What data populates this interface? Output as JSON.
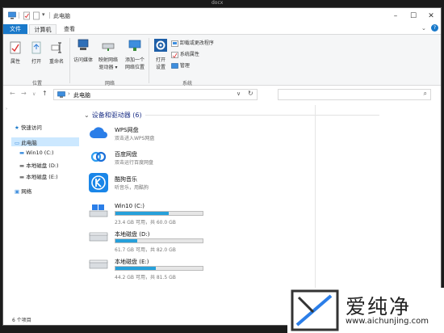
{
  "outer_title": "docx",
  "window": {
    "title": "此电脑"
  },
  "caption": {
    "minimize": "–",
    "maximize": "☐",
    "close": "✕"
  },
  "tabs": {
    "file": "文件",
    "computer": "计算机",
    "view": "查看"
  },
  "ribbon": {
    "location": {
      "properties": "属性",
      "open": "打开",
      "rename": "重命名",
      "group": "位置"
    },
    "network": {
      "access_media": "访问媒体",
      "map_drive_l1": "映射网络",
      "map_drive_l2": "驱动器 ▾",
      "add_location_l1": "添加一个",
      "add_location_l2": "网络位置",
      "group": "网络"
    },
    "system": {
      "open_settings_l1": "打开",
      "open_settings_l2": "设置",
      "uninstall": "卸载或更改程序",
      "sys_properties": "系统属性",
      "manage": "管理",
      "group": "系统"
    }
  },
  "address": {
    "path": "此电脑",
    "search_placeholder": ""
  },
  "nav": {
    "quick_access": "快速访问",
    "this_pc": "此电脑",
    "drives": [
      "Win10 (C:)",
      "本地磁盘 (D:)",
      "本地磁盘 (E:)"
    ],
    "network": "网络"
  },
  "section": {
    "title": "设备和驱动器 (6)"
  },
  "apps": [
    {
      "name": "WPS网盘",
      "sub": "双击进入WPS网盘"
    },
    {
      "name": "百度网盘",
      "sub": "双击运行百度网盘"
    },
    {
      "name": "酷狗音乐",
      "sub": "听音乐，用酷狗"
    }
  ],
  "drives": [
    {
      "name": "Win10 (C:)",
      "free": "23.4 GB 可用，共 60.0 GB",
      "used_pct": 61
    },
    {
      "name": "本地磁盘 (D:)",
      "free": "61.7 GB 可用，共 82.0 GB",
      "used_pct": 25
    },
    {
      "name": "本地磁盘 (E:)",
      "free": "44.2 GB 可用，共 81.5 GB",
      "used_pct": 46
    }
  ],
  "status": {
    "items": "6 个项目"
  },
  "watermark": {
    "brand": "爱纯净",
    "url": "www.aichunjing.com"
  },
  "colors": {
    "accent": "#1979ca",
    "bar": "#26a0da"
  }
}
